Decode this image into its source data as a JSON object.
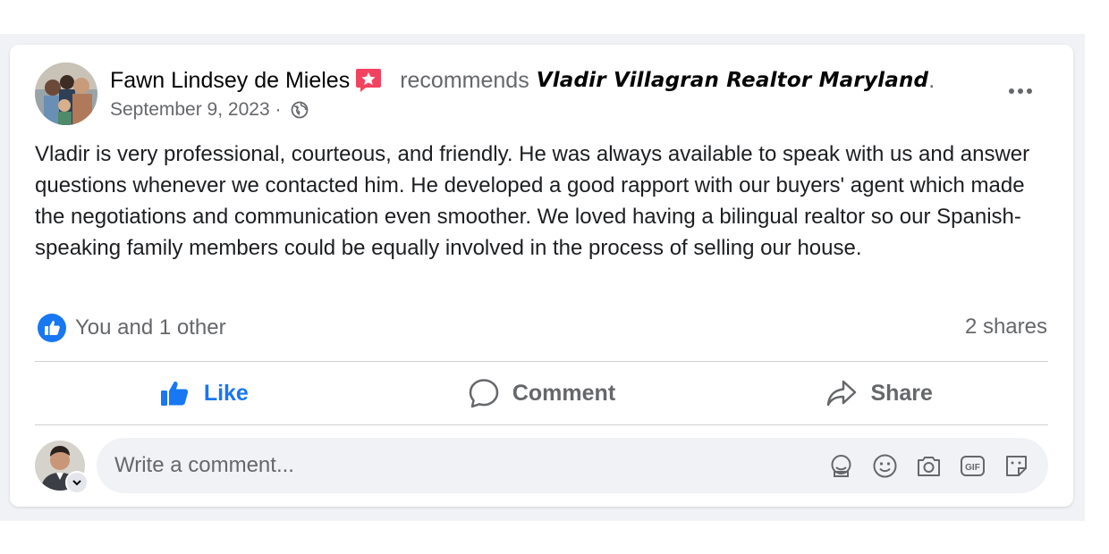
{
  "post": {
    "author": "Fawn Lindsey de Mieles",
    "action_text": "recommends",
    "page_name": "Vladir Villagran Realtor Maryland",
    "period": ".",
    "date": "September 9, 2023",
    "separator": " · ",
    "privacy_icon": "globe-icon",
    "text": "Vladir is very professional, courteous, and friendly. He was always available to speak with us and answer questions whenever we contacted him. He developed a good rapport with our buyers' agent which made the negotiations and communication even smoother. We loved having a bilingual realtor so our Spanish-speaking family members could be equally involved in the process of selling our house."
  },
  "stats": {
    "reactions": "You and 1 other",
    "shares": "2 shares"
  },
  "actions": {
    "like": "Like",
    "comment": "Comment",
    "share": "Share"
  },
  "composer": {
    "placeholder": "Write a comment...",
    "tool_icons": [
      "avatar-sticker-icon",
      "emoji-icon",
      "camera-icon",
      "gif-icon",
      "sticker-icon"
    ]
  },
  "colors": {
    "accent": "#1877f2",
    "secondary_text": "#65676b",
    "recommend_badge": "#f3425f",
    "background": "#f0f2f5"
  }
}
